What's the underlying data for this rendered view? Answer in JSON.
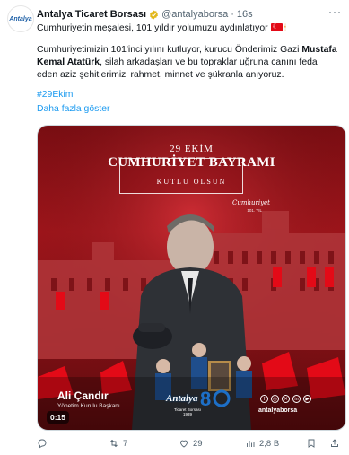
{
  "tweet": {
    "avatar_text": "Antalya",
    "author_name": "Antalya Ticaret Borsası",
    "handle": "@antalyaborsa",
    "time": "16s",
    "more_label": "···",
    "line1": "Cumhuriyetin meşalesi, 101 yıldır yolumuzu aydınlatıyor",
    "body_part1": "Cumhuriyetimizin 101'inci yılını kutluyor, kurucu Önderimiz Gazi ",
    "body_bold": "Mustafa Kemal Atatürk",
    "body_part2": ", silah arkadaşları ve bu topraklar uğruna canını feda eden aziz şehitlerimizi rahmet, minnet ve şükranla anıyoruz.",
    "hashtag": "#29Ekim",
    "show_more": "Daha fazla göster"
  },
  "media": {
    "date": "29 EKİM",
    "title": "CUMHURİYET BAYRAMI",
    "subtitle": "KUTLU OLSUN",
    "signature": "Cumhuriyet",
    "signature_sub": "101. YIL",
    "person_name": "Ali Çandır",
    "person_role": "Yönetim Kurulu Başkanı",
    "logo_text": "Antalya",
    "logo_sub": "Ticaret Borsası 1939",
    "social_handle": "antalyaborsa",
    "video_time": "0:15",
    "colors": {
      "red": "#a3151b",
      "flag": "#e30a17",
      "link": "#1d9bf0"
    }
  },
  "actions": {
    "replies": "",
    "retweets": "7",
    "likes": "29",
    "views": "2,8 B"
  },
  "icons": [
    "verified-badge-icon",
    "more-icon",
    "flag-icon",
    "torch-icon",
    "reply-icon",
    "retweet-icon",
    "like-icon",
    "views-icon",
    "bookmark-icon",
    "share-icon"
  ]
}
